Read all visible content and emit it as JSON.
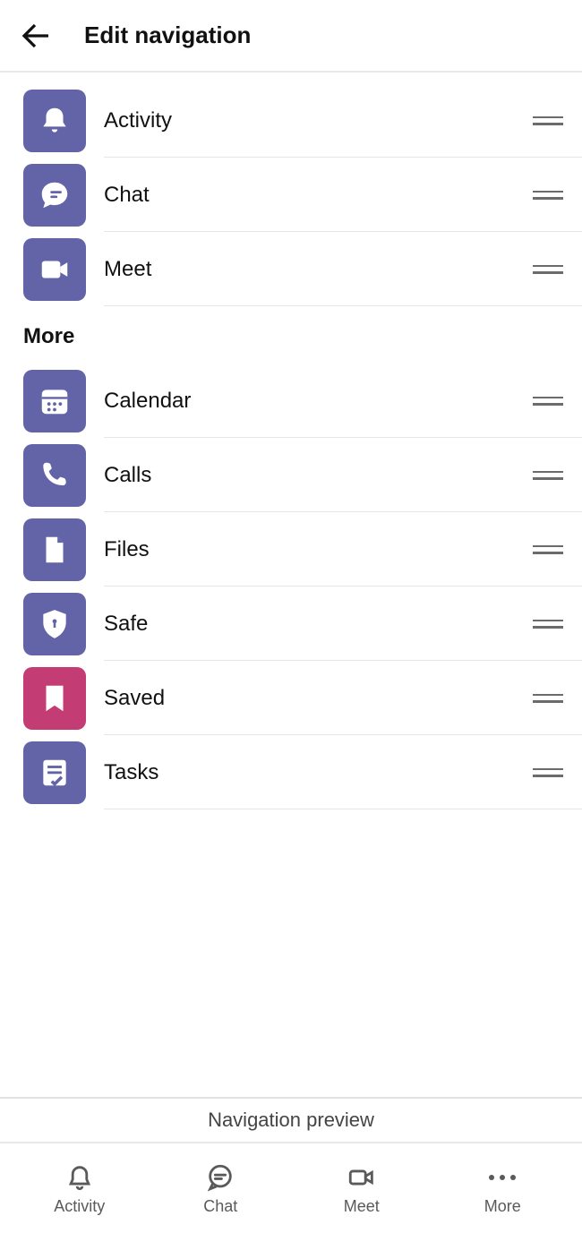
{
  "header": {
    "title": "Edit navigation"
  },
  "colors": {
    "tile_purple": "#6264a7",
    "tile_magenta": "#c33c73"
  },
  "primary": {
    "items": [
      {
        "label": "Activity",
        "icon": "bell",
        "tile": "purple"
      },
      {
        "label": "Chat",
        "icon": "chat",
        "tile": "purple"
      },
      {
        "label": "Meet",
        "icon": "video",
        "tile": "purple"
      }
    ]
  },
  "more": {
    "heading": "More",
    "items": [
      {
        "label": "Calendar",
        "icon": "calendar",
        "tile": "purple"
      },
      {
        "label": "Calls",
        "icon": "phone",
        "tile": "purple"
      },
      {
        "label": "Files",
        "icon": "file",
        "tile": "purple"
      },
      {
        "label": "Safe",
        "icon": "shield",
        "tile": "purple"
      },
      {
        "label": "Saved",
        "icon": "bookmark",
        "tile": "magenta"
      },
      {
        "label": "Tasks",
        "icon": "tasks",
        "tile": "purple"
      }
    ]
  },
  "preview_label": "Navigation preview",
  "bottom_nav": {
    "items": [
      {
        "label": "Activity",
        "icon": "bell"
      },
      {
        "label": "Chat",
        "icon": "chat"
      },
      {
        "label": "Meet",
        "icon": "video"
      },
      {
        "label": "More",
        "icon": "dots"
      }
    ]
  }
}
